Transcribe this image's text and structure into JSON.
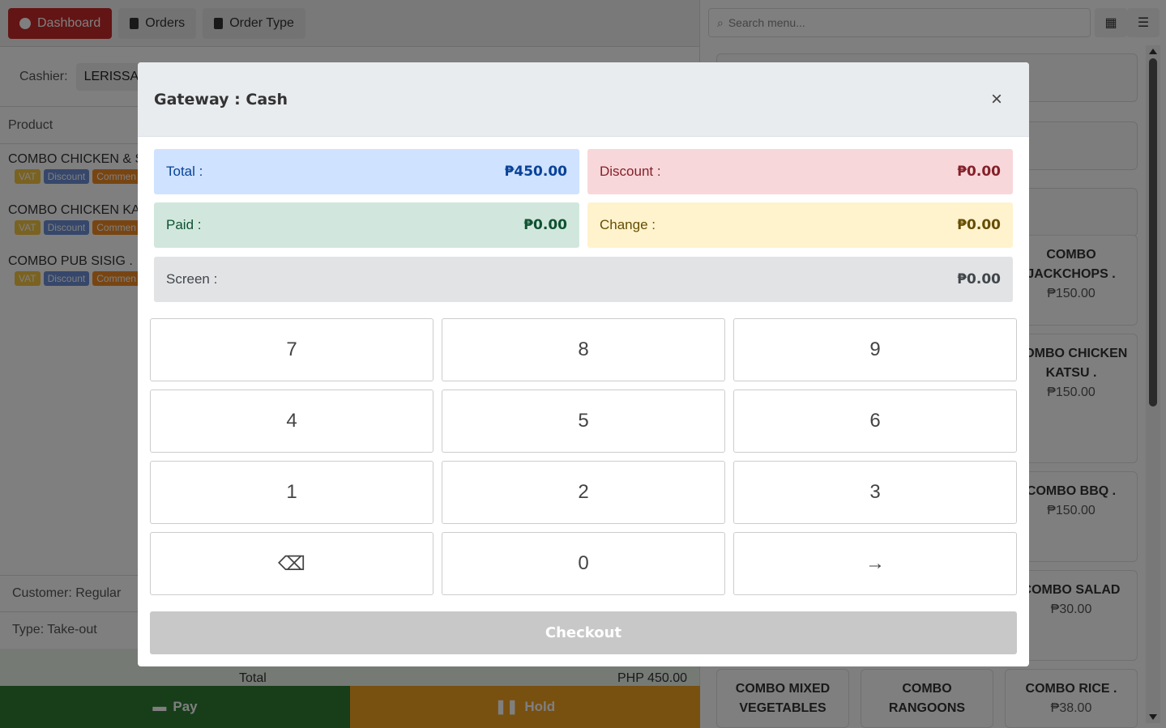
{
  "nav": {
    "dashboard_label": "Dashboard",
    "orders_label": "Orders",
    "order_type_label": "Order Type"
  },
  "cashier": {
    "label": "Cashier:",
    "value": "LERISSA"
  },
  "cart": {
    "header": "Product",
    "items": [
      {
        "name": "COMBO CHICKEN & S",
        "badges": [
          "VAT",
          "Discount",
          "Commen"
        ]
      },
      {
        "name": "COMBO CHICKEN KA",
        "badges": [
          "VAT",
          "Discount",
          "Commen"
        ]
      },
      {
        "name": "COMBO PUB SISIG .",
        "badges": [
          "VAT",
          "Discount",
          "Commen"
        ]
      }
    ]
  },
  "customer": {
    "text": "Customer: Regular"
  },
  "order_type": {
    "text": "Type: Take-out"
  },
  "footer": {
    "total_label": "Total",
    "total_value": "PHP 450.00",
    "pay_label": "Pay",
    "hold_label": "Hold"
  },
  "search": {
    "placeholder": "Search menu..."
  },
  "menu": {
    "cards": [
      {
        "name_line1": "COMBO",
        "name_line2": "JACKCHOPS .",
        "price": "₱150.00"
      },
      {
        "name_line1": "COMBO CHICKEN",
        "name_line2": "KATSU .",
        "price": "₱150.00"
      },
      {
        "name_line1": "COMBO BBQ .",
        "name_line2": "",
        "price": "₱150.00"
      },
      {
        "name_line1": "COMBO SALAD",
        "name_line2": "",
        "price": "₱30.00"
      },
      {
        "name_line1": "COMBO MIXED",
        "name_line2": "VEGETABLES",
        "price": ""
      },
      {
        "name_line1": "COMBO",
        "name_line2": "RANGOONS",
        "price": ""
      },
      {
        "name_line1": "COMBO RICE .",
        "name_line2": "",
        "price": "₱38.00"
      }
    ]
  },
  "modal": {
    "title": "Gateway : Cash",
    "close": "×",
    "total_label": "Total :",
    "total_value": "₱450.00",
    "discount_label": "Discount :",
    "discount_value": "₱0.00",
    "paid_label": "Paid :",
    "paid_value": "₱0.00",
    "change_label": "Change :",
    "change_value": "₱0.00",
    "screen_label": "Screen :",
    "screen_value": "₱0.00",
    "keys": [
      "7",
      "8",
      "9",
      "4",
      "5",
      "6",
      "1",
      "2",
      "3",
      "⌫",
      "0",
      "→"
    ],
    "checkout_label": "Checkout"
  },
  "colors": {
    "dashboard": "#c62828",
    "pay": "#2e7d32",
    "hold": "#f0a020",
    "checkout_disabled": "#c8c8c8"
  }
}
